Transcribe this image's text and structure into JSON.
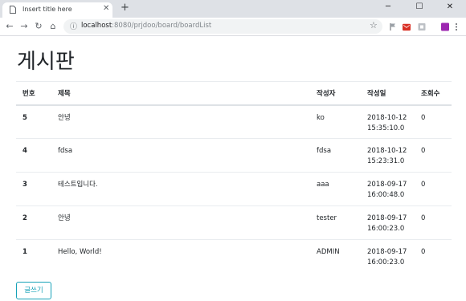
{
  "browser": {
    "tab_title": "Insert title here",
    "tab_close_glyph": "✕",
    "new_tab_glyph": "+",
    "url_host": "localhost",
    "url_path": ":8080/prjdoo/board/boardList",
    "minimize_glyph": "─",
    "maximize_glyph": "☐",
    "close_glyph": "✕",
    "back_glyph": "←",
    "forward_glyph": "→",
    "reload_glyph": "↻",
    "home_glyph": "⌂",
    "info_glyph": "ⓘ",
    "star_glyph": "☆"
  },
  "colors": {
    "accent": "#17a2b8",
    "text": "#212529",
    "chrome": "#dee1e6"
  },
  "page": {
    "title": "게시판"
  },
  "table": {
    "headers": {
      "num": "번호",
      "title": "제목",
      "author": "작성자",
      "date": "작성일",
      "views": "조회수"
    },
    "rows": [
      {
        "num": "5",
        "title": "안녕",
        "author": "ko",
        "date": "2018-10-12",
        "time": "15:35:10.0",
        "views": "0"
      },
      {
        "num": "4",
        "title": "fdsa",
        "author": "fdsa",
        "date": "2018-10-12",
        "time": "15:23:31.0",
        "views": "0"
      },
      {
        "num": "3",
        "title": "테스트입니다.",
        "author": "aaa",
        "date": "2018-09-17",
        "time": "16:00:48.0",
        "views": "0"
      },
      {
        "num": "2",
        "title": "안녕",
        "author": "tester",
        "date": "2018-09-17",
        "time": "16:00:23.0",
        "views": "0"
      },
      {
        "num": "1",
        "title": "Hello, World!",
        "author": "ADMIN",
        "date": "2018-09-17",
        "time": "16:00:23.0",
        "views": "0"
      }
    ]
  },
  "actions": {
    "write_label": "글쓰기"
  }
}
